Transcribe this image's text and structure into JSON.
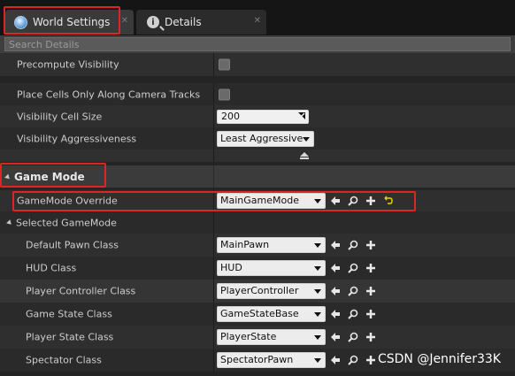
{
  "tabs": [
    {
      "label": "World Settings",
      "icon": "globe-icon",
      "active": true
    },
    {
      "label": "Details",
      "icon": "info-icon",
      "active": false
    }
  ],
  "search": {
    "placeholder": "Search Details",
    "value": ""
  },
  "visibility": {
    "precompute_visibility": {
      "label": "Precompute Visibility",
      "checked": false
    },
    "place_cells": {
      "label": "Place Cells Only Along Camera Tracks",
      "checked": false
    },
    "cell_size": {
      "label": "Visibility Cell Size",
      "value": "200"
    },
    "aggressiveness": {
      "label": "Visibility Aggressiveness",
      "value": "Least Aggressive"
    }
  },
  "game_mode": {
    "category_label": "Game Mode",
    "override": {
      "label": "GameMode Override",
      "value": "MainGameMode"
    },
    "selected_label": "Selected GameMode",
    "classes": [
      {
        "label": "Default Pawn Class",
        "value": "MainPawn"
      },
      {
        "label": "HUD Class",
        "value": "HUD"
      },
      {
        "label": "Player Controller Class",
        "value": "PlayerController"
      },
      {
        "label": "Game State Class",
        "value": "GameStateBase"
      },
      {
        "label": "Player State Class",
        "value": "PlayerState"
      },
      {
        "label": "Spectator Class",
        "value": "SpectatorPawn"
      }
    ]
  },
  "watermark": "CSDN @Jennifer33K",
  "colors": {
    "highlight": "#e02424",
    "background": "#242424"
  }
}
